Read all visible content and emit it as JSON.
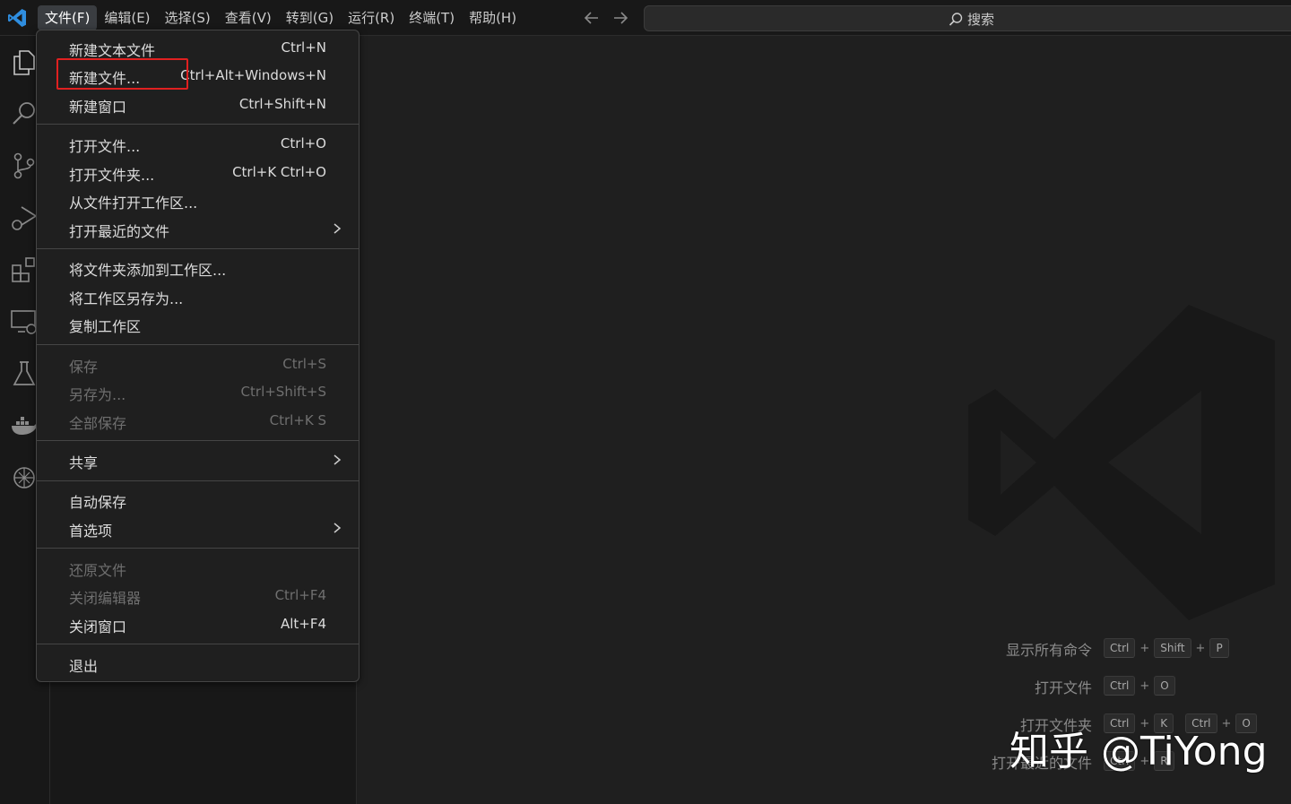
{
  "menubar": {
    "items": [
      "文件(F)",
      "编辑(E)",
      "选择(S)",
      "查看(V)",
      "转到(G)",
      "运行(R)",
      "终端(T)",
      "帮助(H)"
    ]
  },
  "search": {
    "label": "搜索"
  },
  "activity_icons": [
    "files-icon",
    "search-icon",
    "source-control-icon",
    "run-debug-icon",
    "extensions-icon",
    "remote-explorer-icon",
    "testing-icon",
    "docker-icon",
    "chatgpt-icon"
  ],
  "file_menu": {
    "groups": [
      [
        {
          "label": "新建文本文件",
          "shortcut": "Ctrl+N"
        },
        {
          "label": "新建文件...",
          "shortcut": "Ctrl+Alt+Windows+N"
        },
        {
          "label": "新建窗口",
          "shortcut": "Ctrl+Shift+N"
        }
      ],
      [
        {
          "label": "打开文件...",
          "shortcut": "Ctrl+O"
        },
        {
          "label": "打开文件夹...",
          "shortcut": "Ctrl+K Ctrl+O"
        },
        {
          "label": "从文件打开工作区...",
          "shortcut": ""
        },
        {
          "label": "打开最近的文件",
          "shortcut": ""
        }
      ],
      [
        {
          "label": "将文件夹添加到工作区...",
          "shortcut": ""
        },
        {
          "label": "将工作区另存为...",
          "shortcut": ""
        },
        {
          "label": "复制工作区",
          "shortcut": ""
        }
      ],
      [
        {
          "label": "保存",
          "shortcut": "Ctrl+S"
        },
        {
          "label": "另存为...",
          "shortcut": "Ctrl+Shift+S"
        },
        {
          "label": "全部保存",
          "shortcut": "Ctrl+K S"
        }
      ],
      [
        {
          "label": "共享",
          "shortcut": ""
        }
      ],
      [
        {
          "label": "自动保存",
          "shortcut": ""
        },
        {
          "label": "首选项",
          "shortcut": ""
        }
      ],
      [
        {
          "label": "还原文件",
          "shortcut": ""
        },
        {
          "label": "关闭编辑器",
          "shortcut": "Ctrl+F4"
        },
        {
          "label": "关闭窗口",
          "shortcut": "Alt+F4"
        }
      ],
      [
        {
          "label": "退出",
          "shortcut": ""
        }
      ]
    ]
  },
  "shortcuts": [
    {
      "label": "显示所有命令",
      "keys": [
        "Ctrl",
        "+",
        "Shift",
        "+",
        "P"
      ]
    },
    {
      "label": "打开文件",
      "keys": [
        "Ctrl",
        "+",
        "O"
      ]
    },
    {
      "label": "打开文件夹",
      "keys": [
        "Ctrl",
        "+",
        "K",
        "Ctrl",
        "+",
        "O"
      ]
    },
    {
      "label": "打开最近的文件",
      "keys": [
        "Ctrl",
        "+",
        "R"
      ]
    }
  ],
  "watermark_text": "知乎 @TiYong",
  "colors": {
    "accent": "#0078d4",
    "highlight_border": "#e02020",
    "background": "#1f1f1f"
  }
}
